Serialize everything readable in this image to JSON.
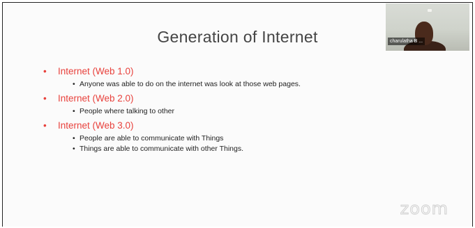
{
  "slide": {
    "title": "Generation of Internet",
    "bullets": [
      {
        "label": "Internet (Web 1.0)",
        "subs": [
          "Anyone was able to do on the internet was look at those web pages."
        ]
      },
      {
        "label": "Internet (Web 2.0)",
        "subs": [
          "People where talking to other"
        ]
      },
      {
        "label": "Internet (Web 3.0)",
        "subs": [
          "People are able to communicate with Things",
          "Things are able to communicate with other Things."
        ]
      }
    ],
    "bullet_glyph": "•"
  },
  "webcam": {
    "participant_name": "charulatha B ..."
  },
  "watermark": {
    "text": "zoom"
  },
  "colors": {
    "heading_bullet": "#e8413c",
    "title_text": "#444444",
    "body_text": "#222222",
    "slide_background": "#fbfbfb"
  }
}
